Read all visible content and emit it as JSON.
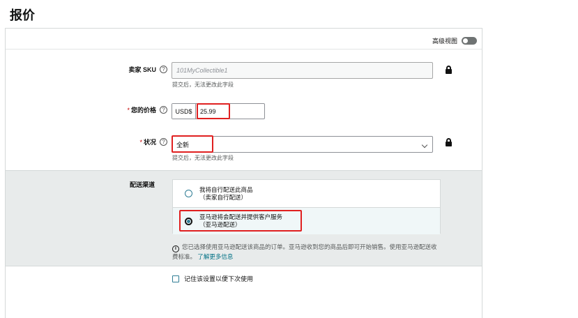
{
  "page": {
    "title": "报价"
  },
  "advanced_view": {
    "label": "高级视图"
  },
  "sku": {
    "label": "卖家 SKU",
    "placeholder": "101MyCollectible1",
    "hint": "提交后，无法更改此字段"
  },
  "price": {
    "label": "您的价格",
    "currency": "USD$",
    "value": "25.99"
  },
  "condition": {
    "label": "状况",
    "value": "全新",
    "hint": "提交后，无法更改此字段"
  },
  "shipping": {
    "label": "配送渠道",
    "options": [
      {
        "title": "我将自行配送此商品",
        "subtitle": "（卖家自行配送）",
        "selected": false
      },
      {
        "title": "亚马逊将会配送并提供客户服务",
        "subtitle": "（亚马逊配送）",
        "selected": true
      }
    ],
    "info_text": "您已选择使用亚马逊配送该商品的订单。亚马逊收到您的商品后即可开始销售。使用亚马逊配送收费标准。",
    "learn_more": "了解更多信息"
  },
  "remember": {
    "label": "记住该设置以便下次使用",
    "checked": false
  },
  "colors": {
    "highlight": "#e02020",
    "link": "#007185",
    "accent": "#2f7d95"
  }
}
